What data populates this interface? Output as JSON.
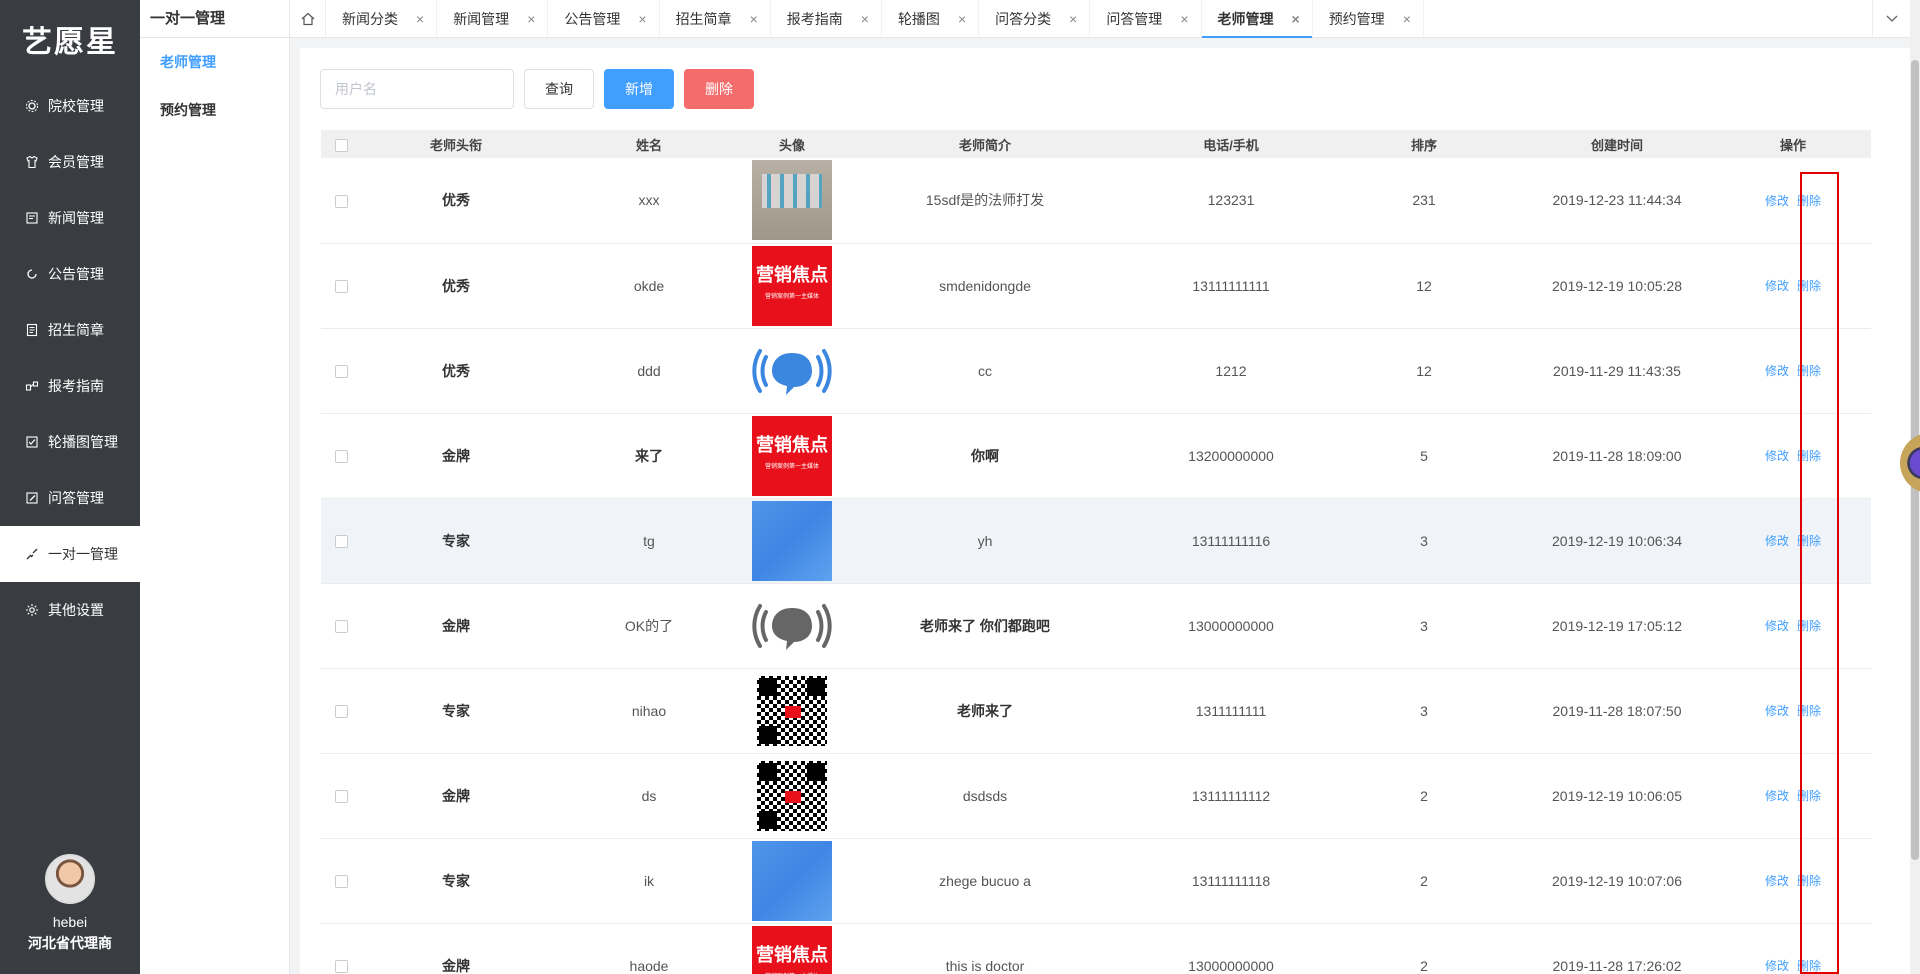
{
  "sidebar": {
    "logo": "艺愿星",
    "items": [
      {
        "label": "院校管理",
        "icon": "gear-icon"
      },
      {
        "label": "会员管理",
        "icon": "shirt-icon"
      },
      {
        "label": "新闻管理",
        "icon": "news-icon"
      },
      {
        "label": "公告管理",
        "icon": "refresh-icon"
      },
      {
        "label": "招生简章",
        "icon": "document-icon"
      },
      {
        "label": "报考指南",
        "icon": "share-icon"
      },
      {
        "label": "轮播图管理",
        "icon": "checkbox-icon"
      },
      {
        "label": "问答管理",
        "icon": "edit-icon"
      },
      {
        "label": "一对一管理",
        "icon": "pen-icon"
      },
      {
        "label": "其他设置",
        "icon": "cog-icon"
      }
    ],
    "active": "一对一管理",
    "user": {
      "name": "hebei",
      "role": "河北省代理商"
    }
  },
  "subsidebar": {
    "title": "一对一管理",
    "items": [
      "老师管理",
      "预约管理"
    ]
  },
  "tabs": [
    {
      "label": "新闻分类"
    },
    {
      "label": "新闻管理"
    },
    {
      "label": "公告管理"
    },
    {
      "label": "招生简章"
    },
    {
      "label": "报考指南"
    },
    {
      "label": "轮播图"
    },
    {
      "label": "问答分类"
    },
    {
      "label": "问答管理"
    },
    {
      "label": "老师管理"
    },
    {
      "label": "预约管理"
    }
  ],
  "active_tab": "老师管理",
  "toolbar": {
    "search_placeholder": "用户名",
    "query_label": "查询",
    "add_label": "新增",
    "delete_label": "删除"
  },
  "table": {
    "headers": [
      "老师头衔",
      "姓名",
      "头像",
      "老师简介",
      "电话/手机",
      "排序",
      "创建时间",
      "操作"
    ],
    "edit_label": "修改",
    "delete_label": "删除",
    "rows": [
      {
        "title": "优秀",
        "name": "xxx",
        "avatar": "photo",
        "intro": "15sdf是的法师打发",
        "phone": "123231",
        "sort": "231",
        "created": "2019-12-23 11:44:34"
      },
      {
        "title": "优秀",
        "name": "okde",
        "avatar": "red-promo",
        "intro": "smdenidongde",
        "phone": "13111111111",
        "sort": "12",
        "created": "2019-12-19 10:05:28"
      },
      {
        "title": "优秀",
        "name": "ddd",
        "avatar": "chat-blue",
        "intro": "cc",
        "phone": "1212",
        "sort": "12",
        "created": "2019-11-29 11:43:35"
      },
      {
        "title": "金牌",
        "name": "来了",
        "avatar": "red-promo",
        "intro": "你啊",
        "phone": "13200000000",
        "sort": "5",
        "created": "2019-11-28 18:09:00"
      },
      {
        "title": "专家",
        "name": "tg",
        "avatar": "blue",
        "intro": "yh",
        "phone": "13111111116",
        "sort": "3",
        "created": "2019-12-19 10:06:34"
      },
      {
        "title": "金牌",
        "name": "OK的了",
        "avatar": "chat-grey",
        "intro": "老师来了 你们都跑吧",
        "phone": "13000000000",
        "sort": "3",
        "created": "2019-12-19 17:05:12"
      },
      {
        "title": "专家",
        "name": "nihao",
        "avatar": "qr",
        "intro": "老师来了",
        "phone": "1311111111",
        "sort": "3",
        "created": "2019-11-28 18:07:50"
      },
      {
        "title": "金牌",
        "name": "ds",
        "avatar": "qr",
        "intro": "dsdsds",
        "phone": "13111111112",
        "sort": "2",
        "created": "2019-12-19 10:06:05"
      },
      {
        "title": "专家",
        "name": "ik",
        "avatar": "blue",
        "intro": "zhege bucuo a",
        "phone": "13111111118",
        "sort": "2",
        "created": "2019-12-19 10:07:06"
      },
      {
        "title": "金牌",
        "name": "haode",
        "avatar": "red-promo",
        "intro": "this is doctor",
        "phone": "13000000000",
        "sort": "2",
        "created": "2019-11-28 17:26:02"
      }
    ],
    "highlight_row": 4
  },
  "promo_text": {
    "main": "营销焦点",
    "sub": "营销案例第一主媒体"
  },
  "colors": {
    "primary": "#409eff",
    "danger": "#f56c6c",
    "sidebar_bg": "#393d42",
    "annotation_box": "#e00000"
  }
}
